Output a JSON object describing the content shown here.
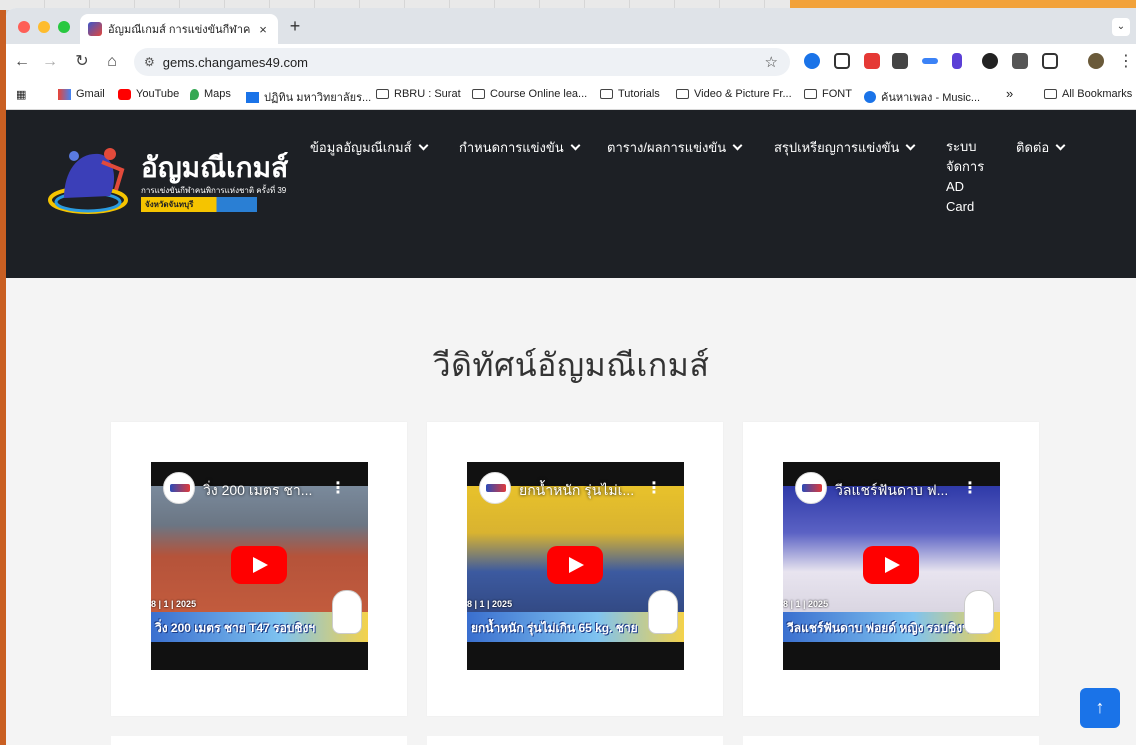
{
  "browser": {
    "tab_title": "อัญมณีเกมส์ การแข่งขันกีฬาคนพิ...",
    "tab_close": "×",
    "new_tab": "+",
    "url": "gems.changames49.com",
    "bookmarks": [
      {
        "label": "Gmail",
        "icon": "gmail-icon"
      },
      {
        "label": "YouTube",
        "icon": "youtube-icon"
      },
      {
        "label": "Maps",
        "icon": "maps-icon"
      },
      {
        "label": "ปฏิทิน มหาวิทยาลัยร...",
        "icon": "calendar-icon"
      },
      {
        "label": "RBRU : Surat",
        "icon": "folder-icon"
      },
      {
        "label": "Course Online lea...",
        "icon": "folder-icon"
      },
      {
        "label": "Tutorials",
        "icon": "folder-icon"
      },
      {
        "label": "Video & Picture Fr...",
        "icon": "folder-icon"
      },
      {
        "label": "FONT",
        "icon": "folder-icon"
      },
      {
        "label": "ค้นหาเพลง - Music...",
        "icon": "shazam-icon"
      }
    ],
    "bookmarks_more": "»",
    "all_bookmarks": "All Bookmarks"
  },
  "site": {
    "logo_title": "อัญมณีเกมส์",
    "logo_subtitle": "การแข่งขันกีฬาคนพิการแห่งชาติ ครั้งที่ 39",
    "logo_province": "จังหวัดจันทบุรี",
    "nav": [
      {
        "label": "ข้อมูลอัญมณีเกมส์",
        "dropdown": true
      },
      {
        "label": "กำหนดการแข่งขัน",
        "dropdown": true
      },
      {
        "label": "ตาราง/ผลการแข่งขัน",
        "dropdown": true
      },
      {
        "label": "สรุปเหรียญการแข่งขัน",
        "dropdown": true
      },
      {
        "label": "ติดต่อ",
        "dropdown": true
      }
    ],
    "nav_system": [
      "ระบบ",
      "จัดการ",
      "AD",
      "Card"
    ],
    "section_title": "วีดิทัศน์อัญมณีเกมส์",
    "videos": [
      {
        "title": "วิ่ง 200 เมตร ชา...",
        "date": "8 | 1 | 2025",
        "caption": "วิ่ง 200 เมตร ชาย T47 รอบชิงฯ"
      },
      {
        "title": "ยกน้ำหนัก รุ่นไม่เ...",
        "date": "8 | 1 | 2025",
        "caption": "ยกน้ำหนัก รุ่นไม่เกิน 65 kg. ชาย"
      },
      {
        "title": "วีลแชร์ฟันดาบ ฟ...",
        "date": "8 | 1 | 2025",
        "caption": "วีลแชร์ฟันดาบ ฟอยด์ หญิง รอบชิงฯ"
      }
    ],
    "scroll_top": "↑"
  },
  "colors": {
    "header_bg": "#1d2025",
    "accent_blue": "#1a73e8",
    "play_red": "#ff0000"
  }
}
